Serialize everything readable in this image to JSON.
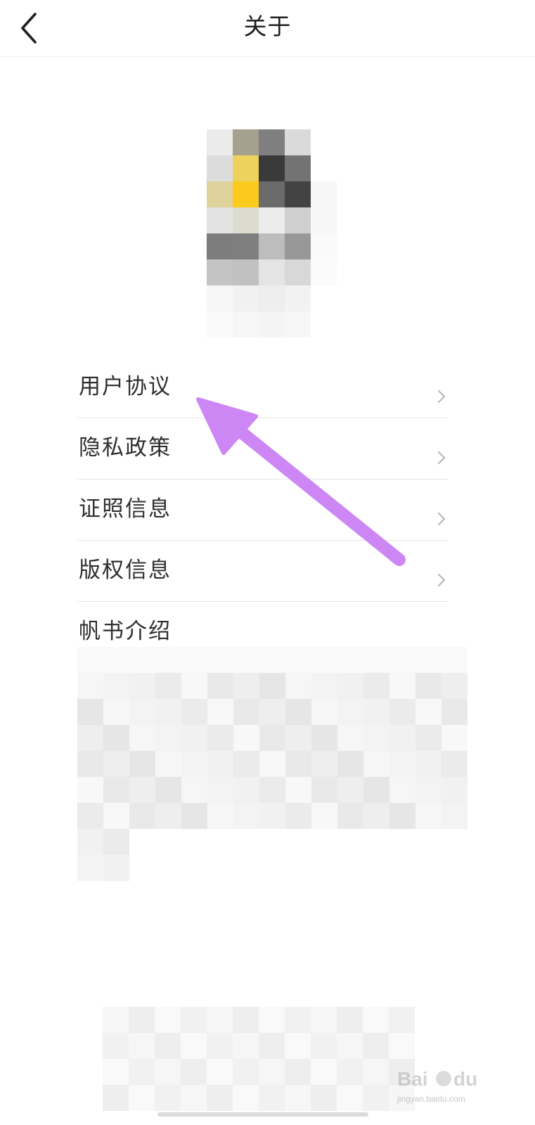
{
  "header": {
    "title": "关于",
    "back_icon": "chevron-left-icon"
  },
  "menu": {
    "items": [
      {
        "label": "用户协议",
        "has_chevron": true
      },
      {
        "label": "隐私政策",
        "has_chevron": true
      },
      {
        "label": "证照信息",
        "has_chevron": true
      },
      {
        "label": "版权信息",
        "has_chevron": true
      },
      {
        "label": "帆书介绍",
        "has_chevron": false
      }
    ]
  },
  "annotation": {
    "color": "#cd87f5",
    "points_to": "用户协议"
  },
  "watermark": {
    "text": "jingyan.baidu.com"
  },
  "colors": {
    "accent_yellow": "#f9c91c",
    "divider": "#e6e6e6",
    "chevron": "#b8b8b8"
  }
}
